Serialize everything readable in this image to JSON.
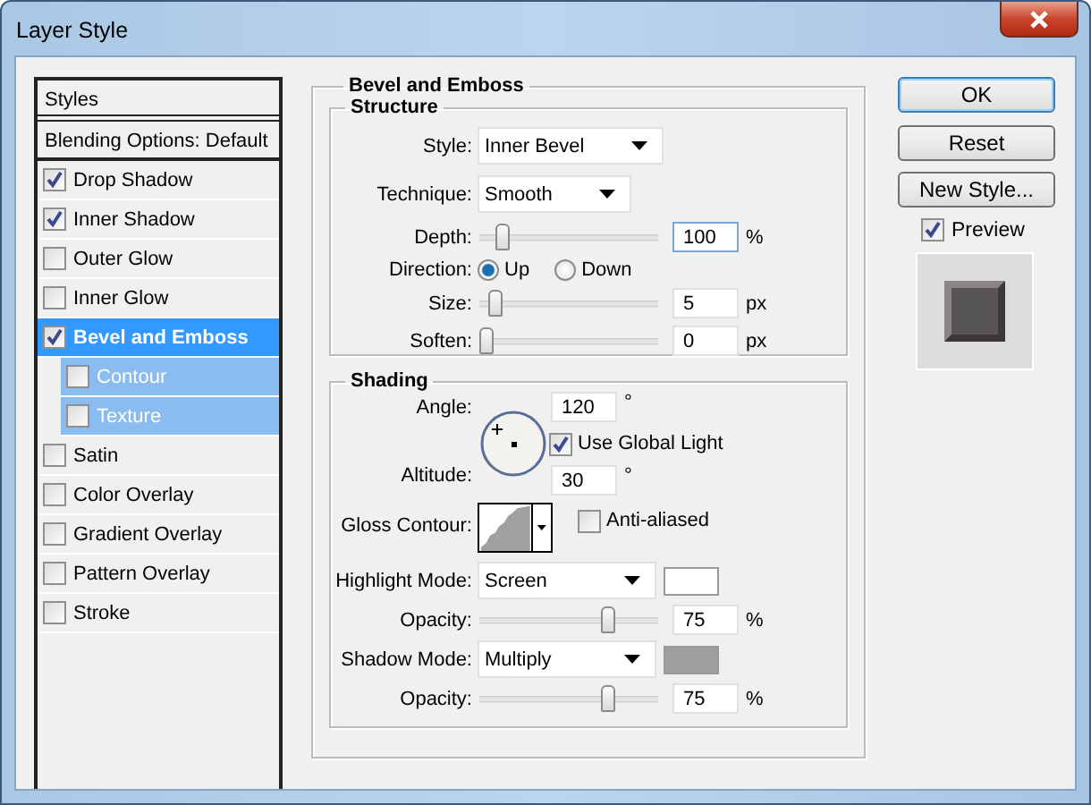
{
  "window": {
    "title": "Layer Style"
  },
  "styles_panel": {
    "header": "Styles",
    "blending": "Blending Options: Default",
    "items": [
      {
        "label": "Drop Shadow",
        "checked": true,
        "selected": false
      },
      {
        "label": "Inner Shadow",
        "checked": true,
        "selected": false
      },
      {
        "label": "Outer Glow",
        "checked": false,
        "selected": false
      },
      {
        "label": "Inner Glow",
        "checked": false,
        "selected": false
      },
      {
        "label": "Bevel and Emboss",
        "checked": true,
        "selected": true,
        "children": [
          {
            "label": "Contour",
            "checked": false,
            "selected": false
          },
          {
            "label": "Texture",
            "checked": false,
            "selected": false
          }
        ]
      },
      {
        "label": "Satin",
        "checked": false,
        "selected": false
      },
      {
        "label": "Color Overlay",
        "checked": false,
        "selected": false
      },
      {
        "label": "Gradient Overlay",
        "checked": false,
        "selected": false
      },
      {
        "label": "Pattern Overlay",
        "checked": false,
        "selected": false
      },
      {
        "label": "Stroke",
        "checked": false,
        "selected": false
      }
    ]
  },
  "bevel_and_emboss": {
    "title": "Bevel and Emboss",
    "structure": {
      "title": "Structure",
      "rows": [
        {
          "kind": "select",
          "label": "Style:",
          "value": "Inner Bevel"
        },
        {
          "kind": "select",
          "label": "Technique:",
          "value": "Smooth"
        },
        {
          "kind": "slider",
          "label": "Depth:",
          "level": 0.1,
          "value": "100",
          "unit": "%",
          "focused": true
        },
        {
          "kind": "radio",
          "label": "Direction:",
          "options": [
            {
              "label": "Up",
              "selected": true
            },
            {
              "label": "Down",
              "selected": false
            }
          ]
        },
        {
          "kind": "slider",
          "label": "Size:",
          "level": 0.05,
          "value": "5",
          "unit": "px",
          "focused": false
        },
        {
          "kind": "slider",
          "label": "Soften:",
          "level": 0,
          "value": "0",
          "unit": "px",
          "focused": false
        }
      ]
    },
    "shading": {
      "title": "Shading",
      "angle": {
        "label": "Angle:",
        "value": "120",
        "unit": "°"
      },
      "use_global_light": {
        "label": "Use Global Light",
        "checked": true
      },
      "altitude": {
        "label": "Altitude:",
        "value": "30",
        "unit": "°"
      },
      "gloss_contour": {
        "label": "Gloss Contour:"
      },
      "anti_aliased": {
        "label": "Anti-aliased",
        "checked": false
      },
      "rows": [
        {
          "kind": "select",
          "label": "Highlight Mode:",
          "value": "Screen",
          "color": "#ffffff"
        },
        {
          "kind": "slider",
          "label": "Opacity:",
          "level": 0.75,
          "value": "75",
          "unit": "%",
          "focused": false
        },
        {
          "kind": "select",
          "label": "Shadow Mode:",
          "value": "Multiply",
          "color": "#9e9e9e"
        },
        {
          "kind": "slider",
          "label": "Opacity:",
          "level": 0.75,
          "value": "75",
          "unit": "%",
          "focused": false
        }
      ]
    }
  },
  "buttons": [
    {
      "label": "OK",
      "default": true
    },
    {
      "label": "Reset",
      "default": false
    },
    {
      "label": "New Style...",
      "default": false
    }
  ],
  "preview": {
    "label": "Preview",
    "checked": true
  }
}
